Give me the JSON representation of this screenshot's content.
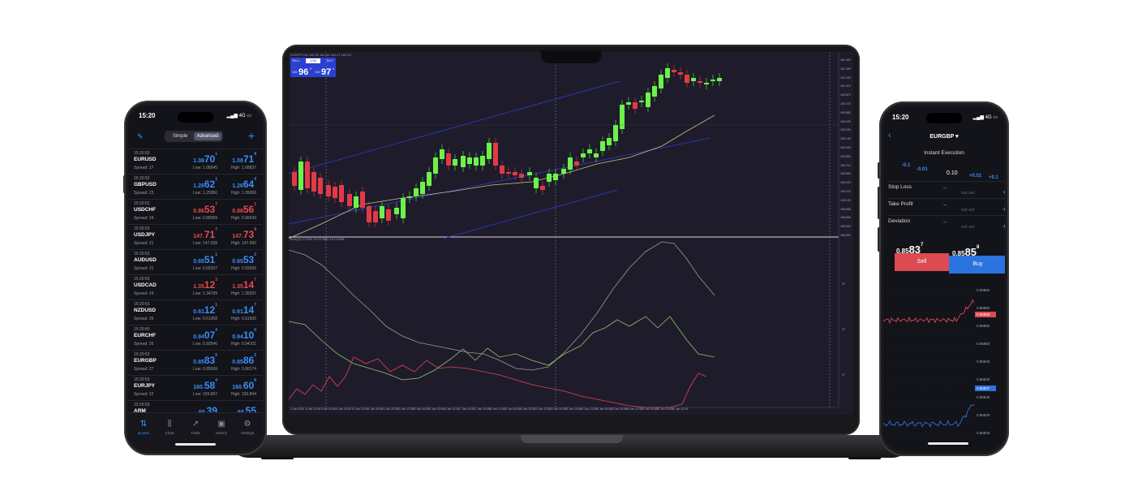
{
  "laptop": {
    "chart_title": "EURJPY,H4  160.38 160.44 160.27 160.29",
    "one_click": {
      "sell_label": "SELL",
      "buy_label": "BUY",
      "lot": "1.00",
      "sell_prefix": "160",
      "sell_big": "96",
      "sell_sup": "9",
      "buy_prefix": "160",
      "buy_big": "97",
      "buy_sup": "4"
    },
    "indicator_label": "ADX(14) 27.2232 +DI 22.3582 -DI 14.4208",
    "price_labels": [
      "161.450",
      "161.305",
      "161.160",
      "161.015",
      "160.870",
      "160.725",
      "160.580",
      "160.435",
      "160.290",
      "160.145",
      "160.000",
      "159.855",
      "159.710",
      "159.565",
      "159.420",
      "159.275",
      "159.130",
      "158.985",
      "158.840",
      "158.695",
      "158.550"
    ],
    "indicator_axis": [
      "57",
      "37",
      "17"
    ],
    "time_labels": [
      "4 Jan 2024",
      "8 Jan 12:00",
      "9 Jan 04:00",
      "9 Jan 20:00",
      "10 Jan 12:00",
      "11 Jan 04:00",
      "11 Jan 20:00",
      "12 Jan 12:00",
      "15 Jan 04:00",
      "15 Jan 20:00",
      "16 Jan 12:00",
      "17 Jan 04:00",
      "17 Jan 20:00",
      "18 Jan 12:00",
      "19 Jan 04:00",
      "19 Jan 20:00",
      "22 Jan 12:00",
      "23 Jan 04:00",
      "23 Jan 20:00",
      "24 Jan 12:00",
      "25 Jan 04:00",
      "25 Jan 20:00",
      "26 Jan 12:00",
      "29 Jan 04:00",
      "29 Jan 20:00",
      "30 Jan 12:00"
    ],
    "colors": {
      "bull": "#6cf24a",
      "bear": "#e23a45",
      "channel": "#2a3fcf",
      "ma": "#c9c07a",
      "adx": "#9a9a9a",
      "plus_di": "#8fc36a",
      "minus_di": "#e0454f"
    }
  },
  "phone_left": {
    "time": "15:20",
    "network": "4G",
    "modes": [
      "Simple",
      "Advanced"
    ],
    "active_mode": "Advanced",
    "quotes": [
      {
        "time": "15:20:53",
        "symbol": "EURUSD",
        "spread": "Spread: 17",
        "bid_pre": "1.08",
        "bid_big": "70",
        "bid_sup": "1",
        "ask_pre": "1.08",
        "ask_big": "71",
        "ask_sup": "8",
        "low": "Low: 1.08545",
        "high": "High: 1.08837",
        "dir": "blue"
      },
      {
        "time": "15:20:52",
        "symbol": "GBPUSD",
        "spread": "Spread: 23",
        "bid_pre": "1.26",
        "bid_big": "62",
        "bid_sup": "1",
        "ask_pre": "1.26",
        "ask_big": "64",
        "ask_sup": "4",
        "low": "Low: 1.25956",
        "high": "High: 1.26956",
        "dir": "blue"
      },
      {
        "time": "15:20:52",
        "symbol": "USDCHF",
        "spread": "Spread: 24",
        "bid_pre": "0.86",
        "bid_big": "53",
        "bid_sup": "7",
        "ask_pre": "0.86",
        "ask_big": "56",
        "ask_sup": "1",
        "low": "Low: 0.85999",
        "high": "High: 0.86549",
        "dir": "red"
      },
      {
        "time": "15:20:53",
        "symbol": "USDJPY",
        "spread": "Spread: 21",
        "bid_pre": "147.",
        "bid_big": "71",
        "bid_sup": "7",
        "ask_pre": "147.",
        "ask_big": "73",
        "ask_sup": "8",
        "low": "Low: 147.038",
        "high": "High: 147.990",
        "dir": "red"
      },
      {
        "time": "15:20:53",
        "symbol": "AUDUSD",
        "spread": "Spread: 21",
        "bid_pre": "0.65",
        "bid_big": "51",
        "bid_sup": "1",
        "ask_pre": "0.65",
        "ask_big": "53",
        "ask_sup": "2",
        "low": "Low: 0.65337",
        "high": "High: 0.65936",
        "dir": "blue"
      },
      {
        "time": "15:20:53",
        "symbol": "USDCAD",
        "spread": "Spread: 24",
        "bid_pre": "1.35",
        "bid_big": "12",
        "bid_sup": "3",
        "ask_pre": "1.35",
        "ask_big": "14",
        "ask_sup": "7",
        "low": "Low: 1.34789",
        "high": "High: 1.35297",
        "dir": "red"
      },
      {
        "time": "15:20:53",
        "symbol": "NZDUSD",
        "spread": "Spread: 26",
        "bid_pre": "0.61",
        "bid_big": "12",
        "bid_sup": "1",
        "ask_pre": "0.61",
        "ask_big": "14",
        "ask_sup": "7",
        "low": "Low: 0.61058",
        "high": "High: 0.61506",
        "dir": "blue"
      },
      {
        "time": "15:20:50",
        "symbol": "EURCHF",
        "spread": "Spread: 26",
        "bid_pre": "0.94",
        "bid_big": "07",
        "bid_sup": "4",
        "ask_pre": "0.94",
        "ask_big": "10",
        "ask_sup": "0",
        "low": "Low: 0.93546",
        "high": "High: 0.94101",
        "dir": "blue"
      },
      {
        "time": "15:20:53",
        "symbol": "EURGBP",
        "spread": "Spread: 27",
        "bid_pre": "0.85",
        "bid_big": "83",
        "bid_sup": "5",
        "ask_pre": "0.85",
        "ask_big": "86",
        "ask_sup": "2",
        "low": "Low: 0.85699",
        "high": "High: 0.86174",
        "dir": "blue"
      },
      {
        "time": "15:20:53",
        "symbol": "EURJPY",
        "spread": "Spread: 22",
        "bid_pre": "160.",
        "bid_big": "58",
        "bid_sup": "4",
        "ask_pre": "160.",
        "ask_big": "60",
        "ask_sup": "6",
        "low": "Low: 159.897",
        "high": "High: 160.844",
        "dir": "blue"
      },
      {
        "time": "22:59:59",
        "symbol": "ARM",
        "spread": "",
        "bid_pre": "68.",
        "bid_big": "39",
        "bid_sup": "",
        "ask_pre": "68.",
        "ask_big": "55",
        "ask_sup": "",
        "low": "",
        "high": "",
        "dir": "blue"
      }
    ],
    "tabs": [
      "Quotes",
      "Chart",
      "Trade",
      "History",
      "Settings"
    ],
    "active_tab": "Quotes"
  },
  "phone_right": {
    "time": "15:20",
    "network": "4G",
    "symbol": "EURGBP ▾",
    "mode": "Instant Execution",
    "steps_left": [
      "-0.1",
      "-0.01"
    ],
    "volume": "0.10",
    "steps_right": [
      "+0.01",
      "+0.1"
    ],
    "rows": [
      {
        "label": "Stop Loss",
        "minus": "–",
        "value": "not set",
        "plus": "+"
      },
      {
        "label": "Take Profit",
        "minus": "–",
        "value": "not set",
        "plus": "+"
      },
      {
        "label": "Deviation",
        "minus": "–",
        "value": "not set",
        "plus": "+"
      }
    ],
    "sell_price": {
      "pre": "0.85",
      "big": "83",
      "sup": "7"
    },
    "buy_price": {
      "pre": "0.85",
      "big": "85",
      "sup": "8"
    },
    "sell_label": "Sell",
    "buy_label": "Buy",
    "upper_axis": [
      "0.85865",
      "0.85860",
      "0.85855",
      "0.85850",
      "0.85845"
    ],
    "lower_axis": [
      "0.85840",
      "0.85835",
      "0.85830",
      "0.85825"
    ],
    "ask_tag": "0.85858",
    "bid_tag": "0.85837"
  }
}
